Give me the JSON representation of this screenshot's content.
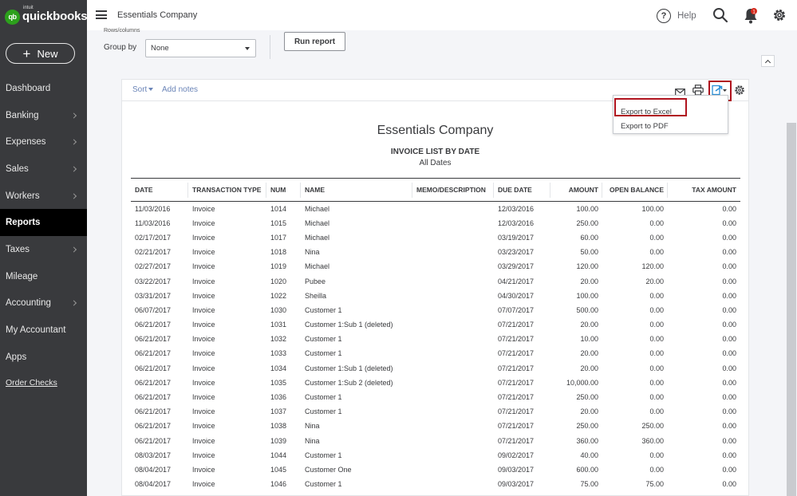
{
  "brand": {
    "intuit": "intuit",
    "name": "quickbooks",
    "mark": "qb"
  },
  "sidebar": {
    "new_label": "New",
    "items": [
      {
        "label": "Dashboard",
        "chevron": false,
        "active": false
      },
      {
        "label": "Banking",
        "chevron": true,
        "active": false
      },
      {
        "label": "Expenses",
        "chevron": true,
        "active": false
      },
      {
        "label": "Sales",
        "chevron": true,
        "active": false
      },
      {
        "label": "Workers",
        "chevron": true,
        "active": false
      },
      {
        "label": "Reports",
        "chevron": false,
        "active": true
      },
      {
        "label": "Taxes",
        "chevron": true,
        "active": false
      },
      {
        "label": "Mileage",
        "chevron": false,
        "active": false
      },
      {
        "label": "Accounting",
        "chevron": true,
        "active": false
      },
      {
        "label": "My Accountant",
        "chevron": false,
        "active": false
      },
      {
        "label": "Apps",
        "chevron": false,
        "active": false
      }
    ],
    "order_checks": "Order Checks"
  },
  "topbar": {
    "company": "Essentials Company",
    "help": "Help",
    "icons": [
      "menu-icon",
      "help-icon",
      "search-icon",
      "notification-bell-icon",
      "gear-icon"
    ],
    "bell_color": "#d52b1e"
  },
  "controls": {
    "rows_columns_label": "Rows/columns",
    "group_by_label": "Group by",
    "group_by_value": "None",
    "run_report": "Run report"
  },
  "report_toolbar": {
    "sort": "Sort",
    "add_notes": "Add notes",
    "icons": [
      "email-icon",
      "print-icon",
      "export-icon",
      "settings-icon"
    ],
    "export_menu": [
      "Export to Excel",
      "Export to PDF"
    ],
    "highlight_color": "#b0131e",
    "link_color": "#6b85b8"
  },
  "report": {
    "company": "Essentials Company",
    "title": "INVOICE LIST BY DATE",
    "subtitle": "All Dates",
    "columns": [
      "DATE",
      "TRANSACTION TYPE",
      "NUM",
      "NAME",
      "MEMO/DESCRIPTION",
      "DUE DATE",
      "AMOUNT",
      "OPEN BALANCE",
      "TAX AMOUNT"
    ],
    "rows": [
      [
        "11/03/2016",
        "Invoice",
        "1014",
        "Michael",
        "",
        "12/03/2016",
        "100.00",
        "100.00",
        "0.00"
      ],
      [
        "11/03/2016",
        "Invoice",
        "1015",
        "Michael",
        "",
        "12/03/2016",
        "250.00",
        "0.00",
        "0.00"
      ],
      [
        "02/17/2017",
        "Invoice",
        "1017",
        "Michael",
        "",
        "03/19/2017",
        "60.00",
        "0.00",
        "0.00"
      ],
      [
        "02/21/2017",
        "Invoice",
        "1018",
        "Nina",
        "",
        "03/23/2017",
        "50.00",
        "0.00",
        "0.00"
      ],
      [
        "02/27/2017",
        "Invoice",
        "1019",
        "Michael",
        "",
        "03/29/2017",
        "120.00",
        "120.00",
        "0.00"
      ],
      [
        "03/22/2017",
        "Invoice",
        "1020",
        "Pubee",
        "",
        "04/21/2017",
        "20.00",
        "20.00",
        "0.00"
      ],
      [
        "03/31/2017",
        "Invoice",
        "1022",
        "Sheilla",
        "",
        "04/30/2017",
        "100.00",
        "0.00",
        "0.00"
      ],
      [
        "06/07/2017",
        "Invoice",
        "1030",
        "Customer 1",
        "",
        "07/07/2017",
        "500.00",
        "0.00",
        "0.00"
      ],
      [
        "06/21/2017",
        "Invoice",
        "1031",
        "Customer 1:Sub 1 (deleted)",
        "",
        "07/21/2017",
        "20.00",
        "0.00",
        "0.00"
      ],
      [
        "06/21/2017",
        "Invoice",
        "1032",
        "Customer 1",
        "",
        "07/21/2017",
        "10.00",
        "0.00",
        "0.00"
      ],
      [
        "06/21/2017",
        "Invoice",
        "1033",
        "Customer 1",
        "",
        "07/21/2017",
        "20.00",
        "0.00",
        "0.00"
      ],
      [
        "06/21/2017",
        "Invoice",
        "1034",
        "Customer 1:Sub 1 (deleted)",
        "",
        "07/21/2017",
        "20.00",
        "0.00",
        "0.00"
      ],
      [
        "06/21/2017",
        "Invoice",
        "1035",
        "Customer 1:Sub 2 (deleted)",
        "",
        "07/21/2017",
        "10,000.00",
        "0.00",
        "0.00"
      ],
      [
        "06/21/2017",
        "Invoice",
        "1036",
        "Customer 1",
        "",
        "07/21/2017",
        "250.00",
        "0.00",
        "0.00"
      ],
      [
        "06/21/2017",
        "Invoice",
        "1037",
        "Customer 1",
        "",
        "07/21/2017",
        "20.00",
        "0.00",
        "0.00"
      ],
      [
        "06/21/2017",
        "Invoice",
        "1038",
        "Nina",
        "",
        "07/21/2017",
        "250.00",
        "250.00",
        "0.00"
      ],
      [
        "06/21/2017",
        "Invoice",
        "1039",
        "Nina",
        "",
        "07/21/2017",
        "360.00",
        "360.00",
        "0.00"
      ],
      [
        "08/03/2017",
        "Invoice",
        "1044",
        "Customer 1",
        "",
        "09/02/2017",
        "40.00",
        "0.00",
        "0.00"
      ],
      [
        "08/04/2017",
        "Invoice",
        "1045",
        "Customer One",
        "",
        "09/03/2017",
        "600.00",
        "0.00",
        "0.00"
      ],
      [
        "08/04/2017",
        "Invoice",
        "1046",
        "Customer 1",
        "",
        "09/03/2017",
        "75.00",
        "75.00",
        "0.00"
      ]
    ]
  }
}
